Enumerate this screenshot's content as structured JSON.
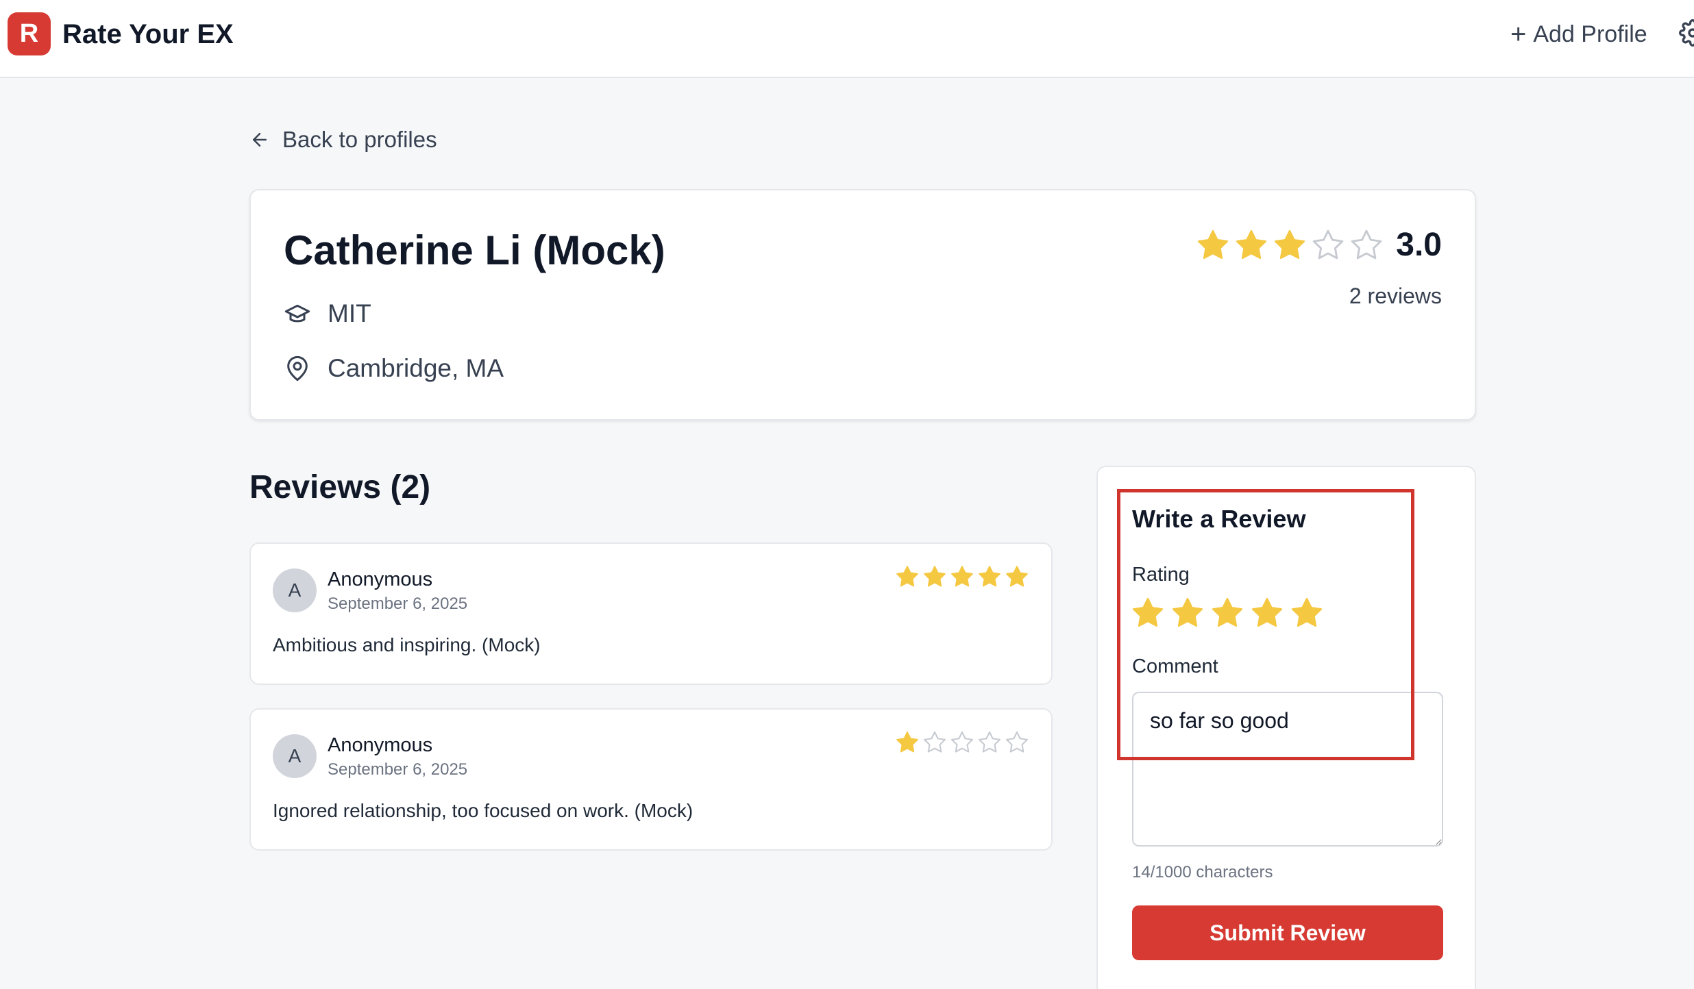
{
  "app": {
    "logo_letter": "R",
    "title": "Rate Your EX"
  },
  "header": {
    "add_profile_label": "Add Profile",
    "plus_icon": "+"
  },
  "nav": {
    "back_label": "Back to profiles"
  },
  "profile": {
    "name": "Catherine Li (Mock)",
    "school": "MIT",
    "location": "Cambridge, MA",
    "rating": 3,
    "rating_display": "3.0",
    "review_count_label": "2 reviews"
  },
  "reviews_section": {
    "heading": "Reviews (2)",
    "items": [
      {
        "avatar": "A",
        "author": "Anonymous",
        "date": "September 6, 2025",
        "rating": 5,
        "text": "Ambitious and inspiring. (Mock)"
      },
      {
        "avatar": "A",
        "author": "Anonymous",
        "date": "September 6, 2025",
        "rating": 1,
        "text": "Ignored relationship, too focused on work. (Mock)"
      }
    ]
  },
  "write_review": {
    "title": "Write a Review",
    "rating_label": "Rating",
    "selected_rating": 5,
    "comment_label": "Comment",
    "comment_value": "so far so good",
    "char_count": "14/1000 characters",
    "submit_label": "Submit Review"
  },
  "colors": {
    "brand": "#d63a32",
    "star_filled": "#f5c842",
    "star_empty": "#c7cbd1"
  }
}
